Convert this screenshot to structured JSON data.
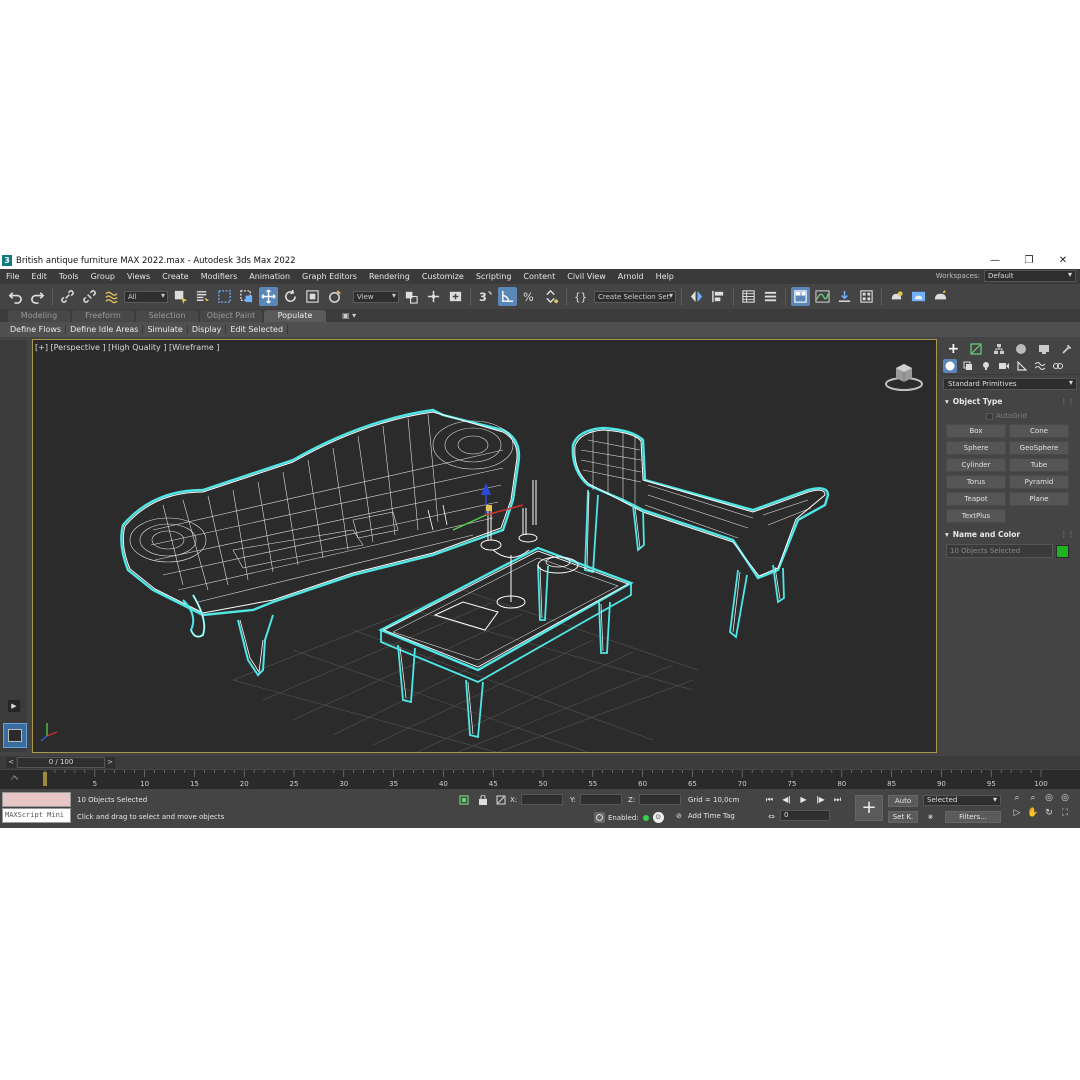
{
  "window": {
    "title": "British antique furniture MAX 2022.max - Autodesk 3ds Max 2022",
    "app_icon": "3",
    "controls": [
      "—",
      "❐",
      "✕"
    ]
  },
  "menu": [
    "File",
    "Edit",
    "Tools",
    "Group",
    "Views",
    "Create",
    "Modifiers",
    "Animation",
    "Graph Editors",
    "Rendering",
    "Customize",
    "Scripting",
    "Content",
    "Civil View",
    "Arnold",
    "Help"
  ],
  "workspaces": {
    "label": "Workspaces:",
    "value": "Default"
  },
  "toolbar": {
    "selection_filter": "All",
    "ref_coord": "View",
    "named_selection": "Create Selection Set",
    "icons": [
      "undo-icon",
      "redo-icon",
      "link-icon",
      "unlink-icon",
      "bind-spacewarp-icon",
      "select-object-icon",
      "select-by-name-icon",
      "rect-region-icon",
      "window-crossing-icon",
      "move-icon",
      "rotate-icon",
      "scale-icon",
      "placement-icon",
      "pivot-icon",
      "manipulate-icon",
      "keyboard-shortcut-icon",
      "snap-3d-icon",
      "angle-snap-icon",
      "percent-snap-icon",
      "spinner-snap-icon",
      "edit-named-sets-icon",
      "mirror-icon",
      "align-icon",
      "scene-explorer-icon",
      "layer-explorer-icon",
      "ribbon-icon",
      "curve-editor-icon",
      "schematic-icon",
      "material-editor-icon",
      "render-setup-icon",
      "rendered-frame-icon",
      "render-icon"
    ]
  },
  "ribbon": {
    "tabs": [
      "Modeling",
      "Freeform",
      "Selection",
      "Object Paint",
      "Populate"
    ],
    "active_tab": "Populate",
    "extra": "▣ ▾",
    "buttons": [
      "Define Flows",
      "Define Idle Areas",
      "Simulate",
      "Display",
      "Edit Selected"
    ]
  },
  "viewport": {
    "label": "[+] [Perspective ] [High Quality ] [Wireframe ]",
    "wire_color": "#ffffff",
    "selection_color": "#4fe6e6",
    "border_color": "#a99750"
  },
  "command_panel": {
    "category_dropdown": "Standard Primitives",
    "object_type_title": "Object Type",
    "autogrid": "AutoGrid",
    "primitives": [
      "Box",
      "Cone",
      "Sphere",
      "GeoSphere",
      "Cylinder",
      "Tube",
      "Torus",
      "Pyramid",
      "Teapot",
      "Plane",
      "TextPlus"
    ],
    "name_color_title": "Name and Color",
    "name_value": "10 Objects Selected",
    "swatch_color": "#1fb31f"
  },
  "time_slider": {
    "value": "0 / 100",
    "prev": "<",
    "next": ">"
  },
  "trackbar": {
    "ticks": [
      "0",
      "5",
      "10",
      "15",
      "20",
      "25",
      "30",
      "35",
      "40",
      "45",
      "50",
      "55",
      "60",
      "65",
      "70",
      "75",
      "80",
      "85",
      "90",
      "95",
      "100"
    ]
  },
  "status": {
    "maxscript": "MAXScript Mini",
    "selection": "10 Objects Selected",
    "prompt": "Click and drag to select and move objects",
    "x_label": "X:",
    "y_label": "Y:",
    "z_label": "Z:",
    "grid": "Grid = 10,0cm",
    "enabled_label": "Enabled:",
    "time_tag": "Add Time Tag",
    "frame": "0",
    "auto": "Auto",
    "set_key": "Set K.",
    "key_filter": "Selected",
    "filters": "Filters..."
  }
}
